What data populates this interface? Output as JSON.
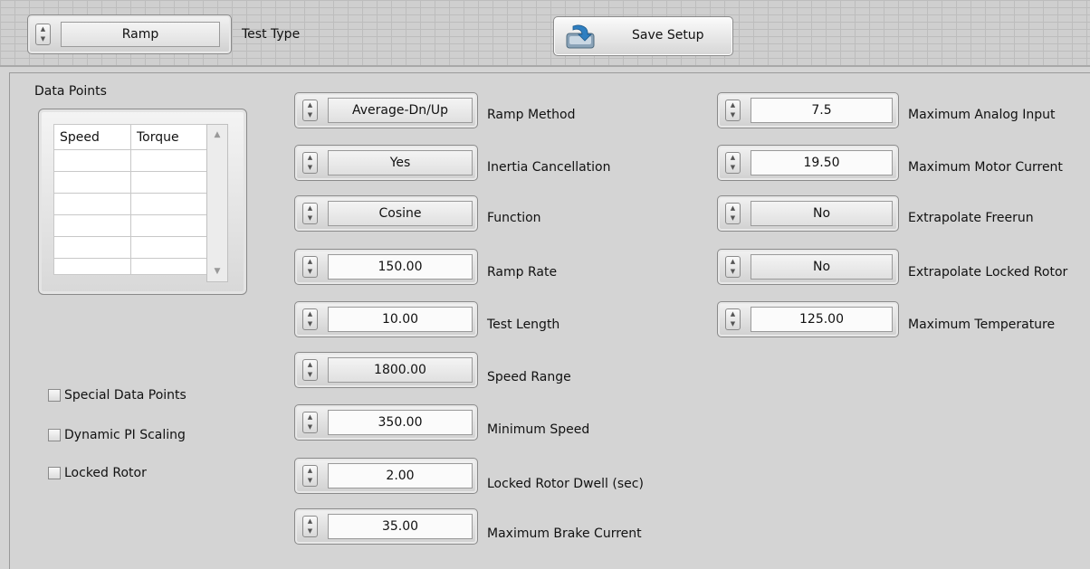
{
  "top": {
    "test_type_value": "Ramp",
    "test_type_label": "Test Type",
    "save_label": "Save Setup"
  },
  "data_points": {
    "title": "Data Points",
    "columns": [
      "Speed",
      "Torque"
    ]
  },
  "checkboxes": [
    {
      "label": "Special Data Points",
      "checked": false
    },
    {
      "label": "Dynamic PI Scaling",
      "checked": false
    },
    {
      "label": "Locked Rotor",
      "checked": false
    }
  ],
  "settings_left": [
    {
      "value": "Average-Dn/Up",
      "label": "Ramp Method"
    },
    {
      "value": "Yes",
      "label": "Inertia Cancellation"
    },
    {
      "value": "Cosine",
      "label": "Function"
    },
    {
      "value": "150.00",
      "label": "Ramp Rate"
    },
    {
      "value": "10.00",
      "label": "Test Length"
    },
    {
      "value": "1800.00",
      "label": "Speed Range"
    },
    {
      "value": "350.00",
      "label": "Minimum Speed"
    },
    {
      "value": "2.00",
      "label": "Locked Rotor Dwell (sec)"
    },
    {
      "value": "35.00",
      "label": "Maximum Brake Current"
    }
  ],
  "settings_right": [
    {
      "value": "7.5",
      "label": "Maximum Analog Input"
    },
    {
      "value": "19.50",
      "label": "Maximum Motor Current"
    },
    {
      "value": "No",
      "label": "Extrapolate Freerun"
    },
    {
      "value": "No",
      "label": "Extrapolate Locked Rotor"
    },
    {
      "value": "125.00",
      "label": "Maximum Temperature"
    }
  ]
}
